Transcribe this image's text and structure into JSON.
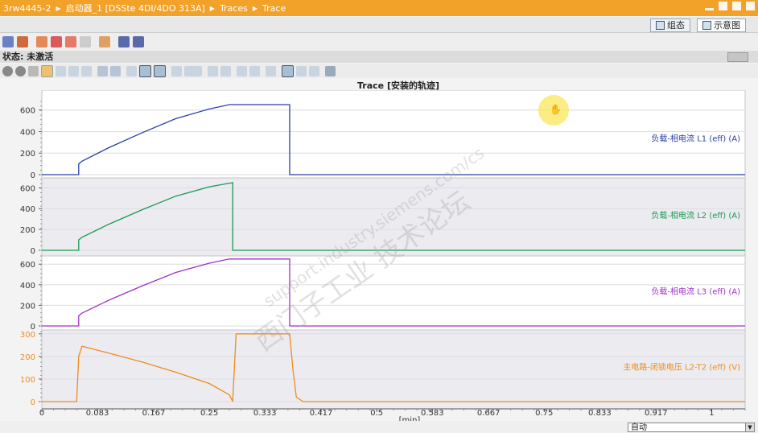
{
  "breadcrumb": [
    "3rw4445-2",
    "启动器_1 [DSSte 4DI/4DO 313A]",
    "Traces",
    "Trace"
  ],
  "tabs": [
    {
      "label": "组态",
      "active": false
    },
    {
      "label": "示意图",
      "active": true
    }
  ],
  "status": {
    "label": "状态:",
    "value": "未激活"
  },
  "chart_title": "Trace [安装的轨迹]",
  "xaxis": {
    "unit": "[min]",
    "ticks": [
      "0",
      "0.083",
      "0.167",
      "0.25",
      "0.333",
      "0.417",
      "0.5",
      "0.583",
      "0.667",
      "0.75",
      "0.833",
      "0.917",
      "1"
    ]
  },
  "scale_select": "自动",
  "watermark": {
    "line1": "西门子工业  技术论坛",
    "line2": "support.industry.siemens.com/cs"
  },
  "colors": {
    "titlebar": "#f3a229",
    "L1": "#2b3ea3",
    "L2": "#1a9a55",
    "L3": "#a030c8",
    "L2T2": "#f08c1c"
  },
  "chart_data": [
    {
      "type": "line",
      "series": [
        {
          "name": "负载-相电流 L1 (eff) (A)",
          "color": "#2b3ea3",
          "x": [
            0,
            0.055,
            0.055,
            0.06,
            0.1,
            0.15,
            0.2,
            0.25,
            0.28,
            0.29,
            0.37,
            0.37,
            1.05
          ],
          "y": [
            0,
            0,
            100,
            125,
            250,
            390,
            520,
            610,
            650,
            650,
            650,
            0,
            0
          ]
        }
      ],
      "yticks": [
        "0",
        "200",
        "400",
        "600"
      ],
      "ylim": [
        0,
        680
      ]
    },
    {
      "type": "line",
      "series": [
        {
          "name": "负载-相电流 L2 (eff) (A)",
          "color": "#1a9a55",
          "x": [
            0,
            0.055,
            0.055,
            0.06,
            0.1,
            0.15,
            0.2,
            0.25,
            0.285,
            0.285,
            1.05
          ],
          "y": [
            0,
            0,
            100,
            125,
            250,
            390,
            520,
            610,
            650,
            0,
            0
          ]
        }
      ],
      "yticks": [
        "0",
        "200",
        "400",
        "600"
      ],
      "ylim": [
        0,
        680
      ]
    },
    {
      "type": "line",
      "series": [
        {
          "name": "负载-相电流 L3 (eff) (A)",
          "color": "#a030c8",
          "x": [
            0,
            0.055,
            0.055,
            0.06,
            0.1,
            0.15,
            0.2,
            0.25,
            0.28,
            0.29,
            0.37,
            0.37,
            1.05
          ],
          "y": [
            0,
            0,
            100,
            125,
            250,
            390,
            520,
            610,
            650,
            650,
            650,
            0,
            0
          ]
        }
      ],
      "yticks": [
        "0",
        "200",
        "400",
        "600"
      ],
      "ylim": [
        0,
        680
      ]
    },
    {
      "type": "line",
      "series": [
        {
          "name": "主电路-闭锁电压 L2-T2 (eff) (V)",
          "color": "#f08c1c",
          "x": [
            0,
            0.052,
            0.055,
            0.06,
            0.1,
            0.15,
            0.2,
            0.25,
            0.28,
            0.285,
            0.29,
            0.37,
            0.375,
            0.38,
            0.39,
            1.05
          ],
          "y": [
            0,
            0,
            200,
            245,
            215,
            175,
            130,
            80,
            30,
            0,
            300,
            300,
            140,
            20,
            0,
            0
          ]
        }
      ],
      "ylabel": "主电路-闭锁电压 L2-T2 (eff) (V)",
      "yticks": [
        "0",
        "100",
        "200",
        "300"
      ],
      "ylim": [
        0,
        310
      ]
    }
  ]
}
